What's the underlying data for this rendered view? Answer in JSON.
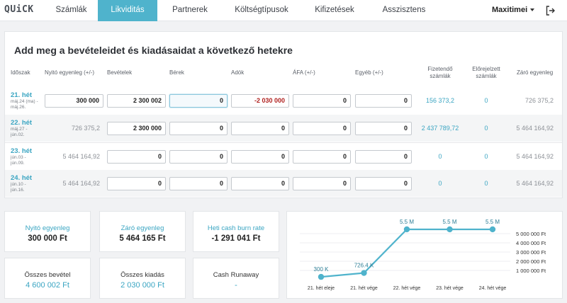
{
  "app": {
    "logo": "QUiCK",
    "user": "Maxitimei"
  },
  "nav": {
    "tabs": [
      "Számlák",
      "Likviditás",
      "Partnerek",
      "Költségtípusok",
      "Kifizetések",
      "Asszisztens"
    ]
  },
  "panel": {
    "title": "Add meg a bevételeidet és kiadásaidat a következő hetekre"
  },
  "table": {
    "headers": {
      "period": "Időszak",
      "opening": "Nyitó egyenleg (+/-)",
      "revenue": "Bevételek",
      "wages": "Bérek",
      "taxes": "Adók",
      "vat": "ÁFA (+/-)",
      "other": "Egyéb (+/-)",
      "payable_line1": "Fizetendő",
      "payable_line2": "számlák",
      "forecast_line1": "Előrejelzett",
      "forecast_line2": "számlák",
      "closing": "Záró egyenleg"
    },
    "rows": [
      {
        "week": "21. hét",
        "date1": "máj.24 (ma) -",
        "date2": "máj.26.",
        "opening": "300 000",
        "revenue": "2 300 002",
        "wages": "0",
        "taxes": "-2 030 000",
        "vat": "0",
        "other": "0",
        "payable": "156 373,2",
        "forecast": "0",
        "closing": "726 375,2"
      },
      {
        "week": "22. hét",
        "date1": "máj.27 -",
        "date2": "jún.02.",
        "opening": "726 375,2",
        "revenue": "2 300 000",
        "wages": "0",
        "taxes": "0",
        "vat": "0",
        "other": "0",
        "payable": "2 437 789,72",
        "forecast": "0",
        "closing": "5 464 164,92"
      },
      {
        "week": "23. hét",
        "date1": "jún.03 -",
        "date2": "jún.09.",
        "opening": "5 464 164,92",
        "revenue": "0",
        "wages": "0",
        "taxes": "0",
        "vat": "0",
        "other": "0",
        "payable": "0",
        "forecast": "0",
        "closing": "5 464 164,92"
      },
      {
        "week": "24. hét",
        "date1": "jún.10 -",
        "date2": "jún.16.",
        "opening": "5 464 164,92",
        "revenue": "0",
        "wages": "0",
        "taxes": "0",
        "vat": "0",
        "other": "0",
        "payable": "0",
        "forecast": "0",
        "closing": "5 464 164,92"
      }
    ]
  },
  "summary": {
    "opening": {
      "label": "Nyitó egyenleg",
      "value": "300 000 Ft"
    },
    "closing": {
      "label": "Záró egyenleg",
      "value": "5 464 165 Ft"
    },
    "burn": {
      "label": "Heti cash burn rate",
      "value": "-1 291 041 Ft"
    },
    "income": {
      "label": "Összes bevétel",
      "value": "4 600 002 Ft"
    },
    "expense": {
      "label": "Összes kiadás",
      "value": "2 030 000 Ft"
    },
    "runaway": {
      "label": "Cash Runaway",
      "value": "-"
    }
  },
  "colors": {
    "accent": "#4fb3cc",
    "teal_text": "#3aa5c2",
    "negative": "#b0211f"
  },
  "chart_data": {
    "type": "line",
    "categories": [
      "21. hét eleje",
      "21. hét vége",
      "22. hét vége",
      "23. hét vége",
      "24. hét vége"
    ],
    "values": [
      300000,
      726375.2,
      5464164.92,
      5464164.92,
      5464164.92
    ],
    "data_labels": [
      "300 K",
      "726.4 K",
      "5.5 M",
      "5.5 M",
      "5.5 M"
    ],
    "y_ticks": [
      "1 000 000 Ft",
      "2 000 000 Ft",
      "3 000 000 Ft",
      "4 000 000 Ft",
      "5 000 000 Ft"
    ],
    "y_tick_values": [
      1000000,
      2000000,
      3000000,
      4000000,
      5000000
    ],
    "ylim": [
      0,
      6000000
    ],
    "grid": true,
    "color": "#4fb3cc"
  }
}
